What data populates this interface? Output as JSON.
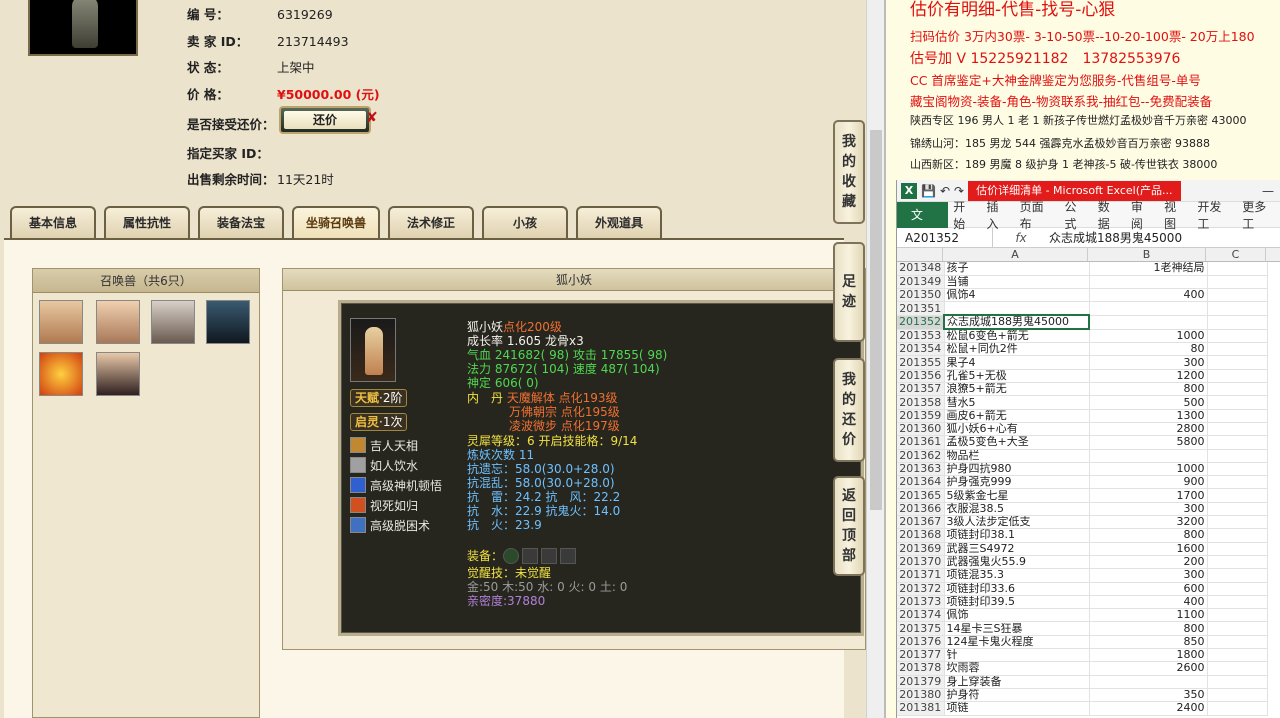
{
  "listing": {
    "rows": [
      {
        "label": "编 号：",
        "value": "6319269"
      },
      {
        "label": "卖 家 ID：",
        "value": "213714493"
      },
      {
        "label": "状 态：",
        "value": "上架中"
      },
      {
        "label": "价 格：",
        "value": "¥50000.00 (元)"
      },
      {
        "label": "是否接受还价：",
        "value": ""
      },
      {
        "label": "指定买家 ID：",
        "value": ""
      },
      {
        "label": "出售剩余时间：",
        "value": "11天21时"
      }
    ],
    "counter_offer_label": "还价"
  },
  "tabs": [
    {
      "label": "基本信息"
    },
    {
      "label": "属性抗性"
    },
    {
      "label": "装备法宝"
    },
    {
      "label": "坐骑召唤兽",
      "active": true
    },
    {
      "label": "法术修正"
    },
    {
      "label": "小孩"
    },
    {
      "label": "外观道具"
    }
  ],
  "pets_panel": {
    "title": "召唤兽（共6只）"
  },
  "pet_detail": {
    "title": "狐小妖",
    "talent_label": "天赋",
    "talent_value": "·2阶",
    "awaken_label": "启灵",
    "awaken_value": "·1次",
    "skills": [
      "吉人天相",
      "如人饮水",
      "高级神机顿悟",
      "视死如归",
      "高级脱困术"
    ],
    "name": "狐小妖",
    "name_suffix": "点化200级",
    "growth": "成长率 1.605 龙骨x3",
    "hp": "气血 241682( 98)",
    "atk": "攻击 17855( 98)",
    "mp": "法力 87672( 104)",
    "spd": "速度 487( 104)",
    "dingli": "神定 606( 0)",
    "neidan": [
      {
        "prefix": "内　丹 ",
        "value": "天魔解体 点化193级"
      },
      {
        "prefix": "",
        "value": "万佛朝宗 点化195级"
      },
      {
        "prefix": "",
        "value": "凌波微步 点化197级"
      }
    ],
    "lingxi": "灵犀等级：6 开启技能格：9/14",
    "lianyao": "炼妖次数 11",
    "resist": [
      "抗遗忘：58.0(30.0+28.0)",
      "抗混乱：58.0(30.0+28.0)",
      "抗　雷：24.2 抗　风：22.2",
      "抗　水：22.9 抗鬼火：14.0",
      "抗　火：23.9"
    ],
    "equip_label": "装备：",
    "awaken_skill": "觉醒技：未觉醒",
    "elements": "金:50 木:50 水: 0 火: 0 土: 0",
    "intimacy": "亲密度:37880"
  },
  "side_buttons": [
    {
      "label": "我的收藏",
      "chars": [
        "我",
        "的",
        "收",
        "藏"
      ]
    },
    {
      "label": "足迹",
      "chars": [
        "足",
        "迹"
      ]
    },
    {
      "label": "我的还价",
      "chars": [
        "我",
        "的",
        "还",
        "价"
      ]
    },
    {
      "label": "返回顶部",
      "chars": [
        "返",
        "回",
        "顶",
        "部"
      ]
    }
  ],
  "notes": [
    "估价有明细-代售-找号-心狠",
    "扫码估价 3万内30票- 3-10-50票--10-20-100票- 20万上180",
    "估号加 V 15225921182　13782553976",
    "CC 首席鉴定+大神金牌鉴定为您服务-代售组号-单号",
    "藏宝阁物资-装备-角色-物资联系我-抽红包--免费配装备",
    "陕西专区 196 男人 1 老 1 新孩子传世燃灯孟极妙音千万亲密 43000",
    "锦绣山河：185 男龙 544 强霹克水孟极妙音百万亲密 93888",
    "山西新区：189 男魔 8 级护身 1 老神孩-5 破-传世铁衣 38000"
  ],
  "excel": {
    "window_title": "估价详细清单 - Microsoft Excel(产品...",
    "ribbon_tabs": [
      "文件",
      "开始",
      "插入",
      "页面布",
      "公式",
      "数据",
      "审阅",
      "视图",
      "开发工",
      "更多工"
    ],
    "name_box": "A201352",
    "formula": "众志成城188男鬼45000",
    "columns": [
      "A",
      "B",
      "C"
    ],
    "rows": [
      [
        "201348",
        "孩子",
        "1老神结局"
      ],
      [
        "201349",
        "当铺",
        ""
      ],
      [
        "201350",
        "佩饰4",
        "400"
      ],
      [
        "201351",
        "",
        ""
      ],
      [
        "201352",
        "众志成城188男鬼45000",
        ""
      ],
      [
        "201353",
        "松鼠6变色+箭无",
        "1000"
      ],
      [
        "201354",
        "松鼠+同仇2件",
        "80"
      ],
      [
        "201355",
        "果子4",
        "300"
      ],
      [
        "201356",
        "孔雀5+无极",
        "1200"
      ],
      [
        "201357",
        "浪獠5+箭无",
        "800"
      ],
      [
        "201358",
        "彗水5",
        "500"
      ],
      [
        "201359",
        "画皮6+箭无",
        "1300"
      ],
      [
        "201360",
        "狐小妖6+心有",
        "2800"
      ],
      [
        "201361",
        "孟极5变色+大圣",
        "5800"
      ],
      [
        "201362",
        "物品栏",
        ""
      ],
      [
        "201363",
        "护身四抗980",
        "1000"
      ],
      [
        "201364",
        "护身强克999",
        "900"
      ],
      [
        "201365",
        "5级紫金七星",
        "1700"
      ],
      [
        "201366",
        "衣服混38.5",
        "300"
      ],
      [
        "201367",
        "3级人法步定低支",
        "3200"
      ],
      [
        "201368",
        "项链封印38.1",
        "800"
      ],
      [
        "201369",
        "武器三S4972",
        "1600"
      ],
      [
        "201370",
        "武器强鬼火55.9",
        "200"
      ],
      [
        "201371",
        "项链混35.3",
        "300"
      ],
      [
        "201372",
        "项链封印33.6",
        "600"
      ],
      [
        "201373",
        "项链封印39.5",
        "400"
      ],
      [
        "201374",
        "佩饰",
        "1100"
      ],
      [
        "201375",
        "14星卡三S狂暴",
        "800"
      ],
      [
        "201376",
        "124星卡鬼火程度",
        "850"
      ],
      [
        "201377",
        "针",
        "1800"
      ],
      [
        "201378",
        "坎雨蓉",
        "2600"
      ],
      [
        "201379",
        "身上穿装备",
        ""
      ],
      [
        "201380",
        "护身符",
        "350"
      ],
      [
        "201381",
        "项链",
        "2400"
      ]
    ]
  }
}
